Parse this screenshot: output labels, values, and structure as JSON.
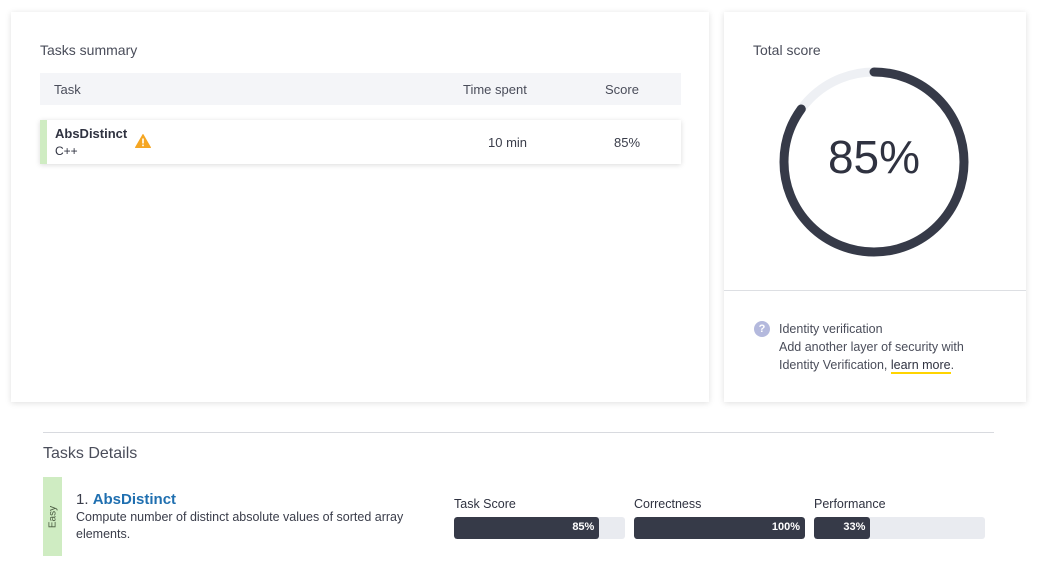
{
  "summary": {
    "title": "Tasks summary",
    "columns": {
      "task": "Task",
      "time": "Time spent",
      "score": "Score"
    },
    "rows": [
      {
        "name": "AbsDistinct",
        "language": "C++",
        "time": "10 min",
        "score": "85%",
        "warning_icon": "warning-triangle-icon"
      }
    ]
  },
  "total": {
    "title": "Total score",
    "value_text": "85%",
    "value": 85,
    "ring_color": "#363a48",
    "track_color": "#eef0f4"
  },
  "identity": {
    "icon": "question-icon",
    "title": "Identity verification",
    "line1": "Add another layer of security with",
    "line2_prefix": "Identity Verification, ",
    "link": "learn more",
    "suffix": "."
  },
  "details": {
    "title": "Tasks Details",
    "tasks": [
      {
        "difficulty": "Easy",
        "number": "1.",
        "name": "AbsDistinct",
        "description": "Compute number of distinct absolute values of sorted array elements.",
        "metrics": [
          {
            "label": "Task Score",
            "text": "85%",
            "value": 85
          },
          {
            "label": "Correctness",
            "text": "100%",
            "value": 100
          },
          {
            "label": "Performance",
            "text": "33%",
            "value": 33
          }
        ]
      }
    ]
  },
  "colors": {
    "accent_green": "#cfecc2",
    "bar_dark": "#363a48",
    "link_blue": "#1f6fb0",
    "warning": "#f5a623"
  }
}
